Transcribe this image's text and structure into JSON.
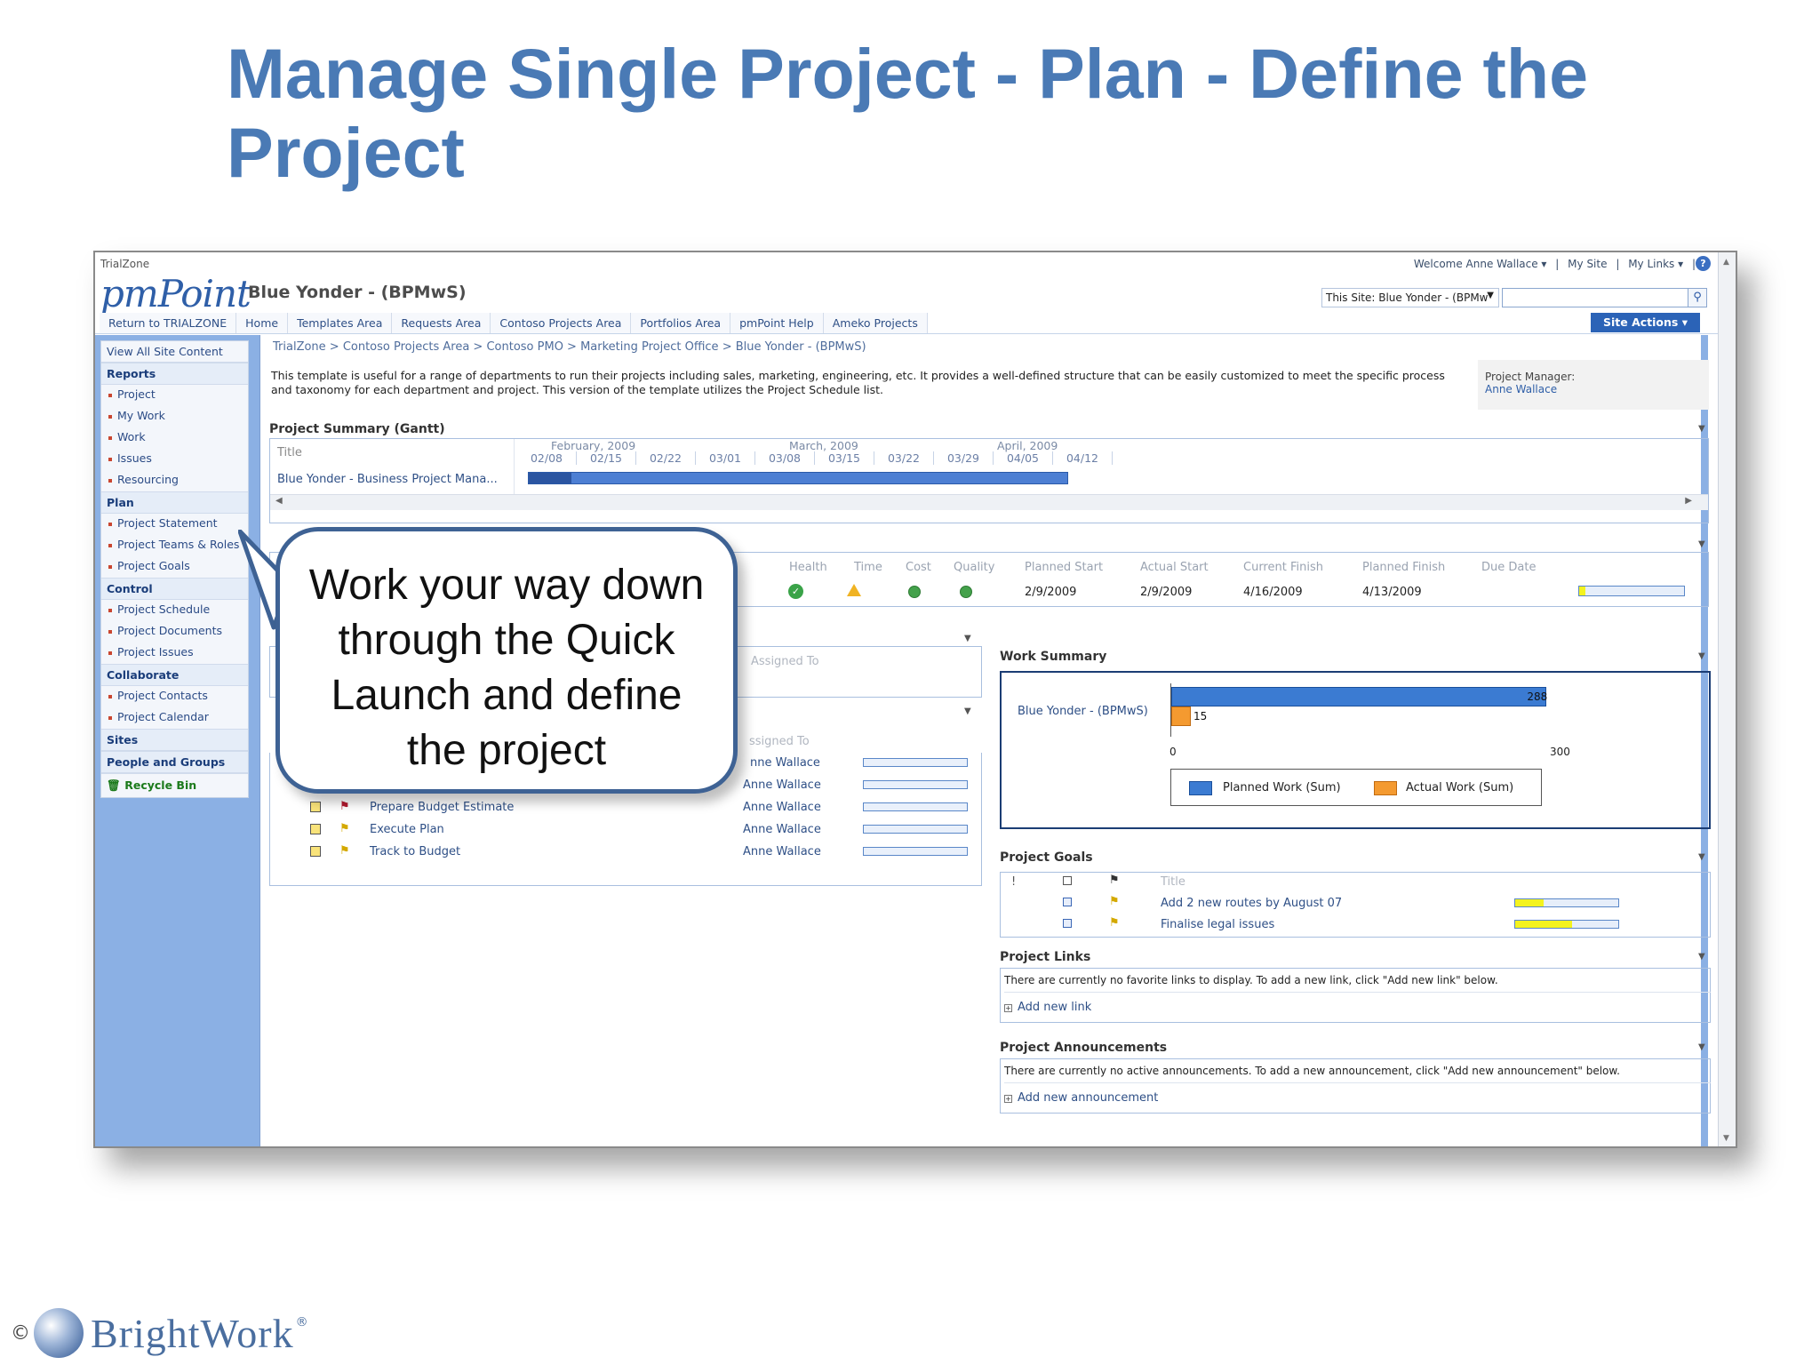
{
  "slide": {
    "title": "Manage Single Project - Plan - Define the Project"
  },
  "topbar": {
    "site_name": "TrialZone",
    "welcome": "Welcome Anne Wallace ▾",
    "my_site": "My Site",
    "my_links": "My Links ▾",
    "help_icon": "?"
  },
  "header": {
    "logo": "pmPoint",
    "site_title": "Blue Yonder - (BPMwS)",
    "search_scope": "This Site: Blue Yonder - (BPMw",
    "search_placeholder": "",
    "search_icon": "search-icon"
  },
  "topnav": {
    "tabs": [
      "Return to TRIALZONE",
      "Home",
      "Templates Area",
      "Requests Area",
      "Contoso Projects Area",
      "Portfolios Area",
      "pmPoint Help",
      "Ameko Projects"
    ],
    "site_actions": "Site Actions ▾"
  },
  "leftnav": {
    "view_all": "View All Site Content",
    "reports": {
      "heading": "Reports",
      "items": [
        "Project",
        "My Work",
        "Work",
        "Issues",
        "Resourcing"
      ]
    },
    "plan": {
      "heading": "Plan",
      "items": [
        "Project Statement",
        "Project Teams & Roles",
        "Project Goals"
      ]
    },
    "control": {
      "heading": "Control",
      "items": [
        "Project Schedule",
        "Project Documents",
        "Project Issues"
      ]
    },
    "collaborate": {
      "heading": "Collaborate",
      "items": [
        "Project Contacts",
        "Project Calendar"
      ]
    },
    "sites": "Sites",
    "people": "People and Groups",
    "recycle": "Recycle Bin"
  },
  "main": {
    "breadcrumb": "TrialZone > Contoso Projects Area > Contoso PMO > Marketing Project Office > Blue Yonder - (BPMwS)",
    "description": "This template is useful for a range of departments to run their projects including sales, marketing, engineering, etc. It provides a well-defined structure that can be easily customized to meet the specific process and taxonomy for each department and project. This version of the template utilizes the Project Schedule list.",
    "project_manager_label": "Project Manager:",
    "project_manager": "Anne Wallace",
    "gantt": {
      "section_title": "Project Summary (Gantt)",
      "title_header": "Title",
      "row_title": "Blue Yonder - Business Project Mana...",
      "months": [
        "February, 2009",
        "March, 2009",
        "April, 2009"
      ],
      "weeks": [
        "02/08",
        "02/15",
        "02/22",
        "03/01",
        "03/08",
        "03/15",
        "03/22",
        "03/29",
        "04/05",
        "04/12"
      ]
    },
    "status": {
      "headers": {
        "health": "Health",
        "time": "Time",
        "cost": "Cost",
        "quality": "Quality",
        "planned_start": "Planned Start",
        "actual_start": "Actual Start",
        "current_finish": "Current Finish",
        "planned_finish": "Planned Finish",
        "due_date": "Due Date"
      },
      "values": {
        "planned_start": "2/9/2009",
        "actual_start": "2/9/2009",
        "current_finish": "4/16/2009",
        "planned_finish": "4/13/2009"
      },
      "due_progress": 0.06
    },
    "tasks": {
      "assigned_header_1": "Assigned To",
      "assigned_header_2": "ssigned To",
      "rows": [
        {
          "name": "",
          "assignee": "nne Wallace"
        },
        {
          "name": "",
          "assignee": "Anne Wallace"
        },
        {
          "name": "Prepare Budget Estimate",
          "assignee": "Anne Wallace"
        },
        {
          "name": "Execute Plan",
          "assignee": "Anne Wallace"
        },
        {
          "name": "Track to Budget",
          "assignee": "Anne Wallace"
        }
      ]
    },
    "work_summary": {
      "section_title": "Work Summary",
      "row_label": "Blue Yonder - (BPMwS)",
      "legend_planned": "Planned Work (Sum)",
      "legend_actual": "Actual Work (Sum)",
      "colors": {
        "planned": "#3b7bd2",
        "actual": "#f49a30"
      }
    },
    "goals": {
      "section_title": "Project Goals",
      "title_header": "Title",
      "rows": [
        {
          "title": "Add 2 new routes by August 07",
          "progress": 0.28
        },
        {
          "title": "Finalise legal issues",
          "progress": 0.55
        }
      ]
    },
    "links": {
      "section_title": "Project Links",
      "message": "There are currently no favorite links to display. To add a new link, click \"Add new link\" below.",
      "add": "Add new link"
    },
    "announcements": {
      "section_title": "Project Announcements",
      "message": "There are currently no active announcements. To add a new announcement, click \"Add new announcement\" below.",
      "add": "Add new announcement"
    }
  },
  "callout": {
    "text": "Work your way down through the Quick Launch and define the project"
  },
  "footer": {
    "copyright": "©",
    "brand": "BrightWork",
    "trademark": "®"
  },
  "chart_data": {
    "type": "bar",
    "title": "Work Summary",
    "categories": [
      "Blue Yonder - (BPMwS)"
    ],
    "series": [
      {
        "name": "Planned Work (Sum)",
        "values": [
          288
        ]
      },
      {
        "name": "Actual Work (Sum)",
        "values": [
          15
        ]
      }
    ],
    "xlim": [
      0,
      300
    ],
    "xticks": [
      0,
      300
    ],
    "orientation": "horizontal",
    "legend": "bottom"
  }
}
